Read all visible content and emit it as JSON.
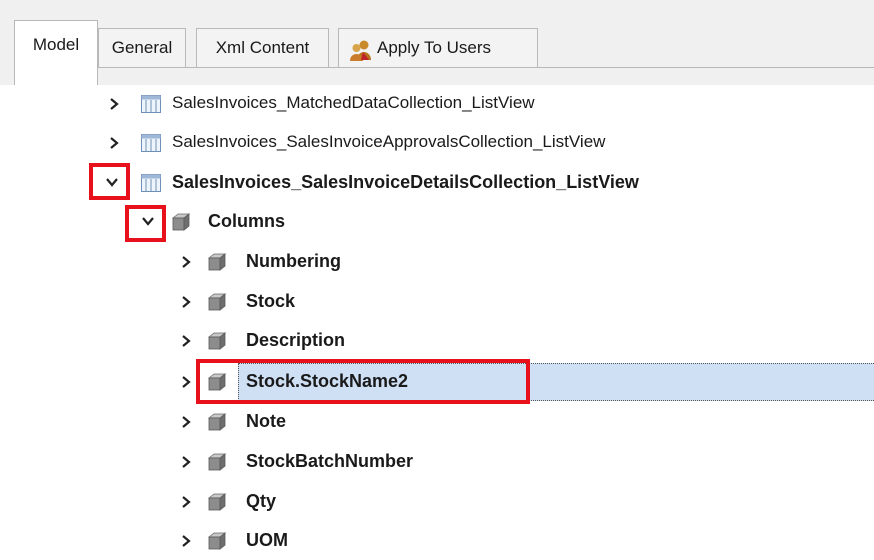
{
  "tabs": {
    "model": "Model",
    "general": "General",
    "xml_content": "Xml Content",
    "apply_to_users": "Apply To Users"
  },
  "tree": {
    "listviews": [
      {
        "label": "SalesInvoices_MatchedDataCollection_ListView",
        "expanded": false
      },
      {
        "label": "SalesInvoices_SalesInvoiceApprovalsCollection_ListView",
        "expanded": false
      },
      {
        "label": "SalesInvoices_SalesInvoiceDetailsCollection_ListView",
        "expanded": true
      }
    ],
    "columns_label": "Columns",
    "columns": [
      {
        "label": "Numbering"
      },
      {
        "label": "Stock"
      },
      {
        "label": "Description"
      },
      {
        "label": "Stock.StockName2",
        "selected": true
      },
      {
        "label": "Note"
      },
      {
        "label": "StockBatchNumber"
      },
      {
        "label": "Qty"
      },
      {
        "label": "UOM"
      }
    ]
  },
  "colors": {
    "highlight_red": "#e8101b",
    "selection": "#cfe0f5"
  },
  "icons": {
    "listview": "listview-table-icon",
    "node": "gray-cube-icon",
    "users": "users-icon"
  }
}
